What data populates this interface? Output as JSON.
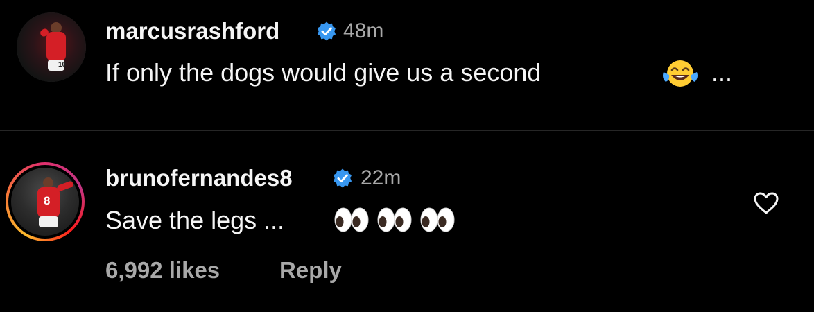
{
  "comments": [
    {
      "username": "marcusrashford",
      "time": "48m",
      "text": "If only the dogs would give us a second",
      "trailing": "..."
    },
    {
      "username": "brunofernandes8",
      "time": "22m",
      "text": "Save the legs ...",
      "jersey_number": "8",
      "likes": "6,992 likes",
      "reply_label": "Reply"
    }
  ],
  "icons": {
    "verified": "verified-badge-icon",
    "emoji_laugh": "face-with-tears-of-joy-icon",
    "emoji_eyes": "eyes-icon",
    "like": "heart-outline-icon"
  },
  "colors": {
    "background": "#000000",
    "verified_blue": "#3897f0",
    "secondary_text": "#a8a8a8"
  }
}
